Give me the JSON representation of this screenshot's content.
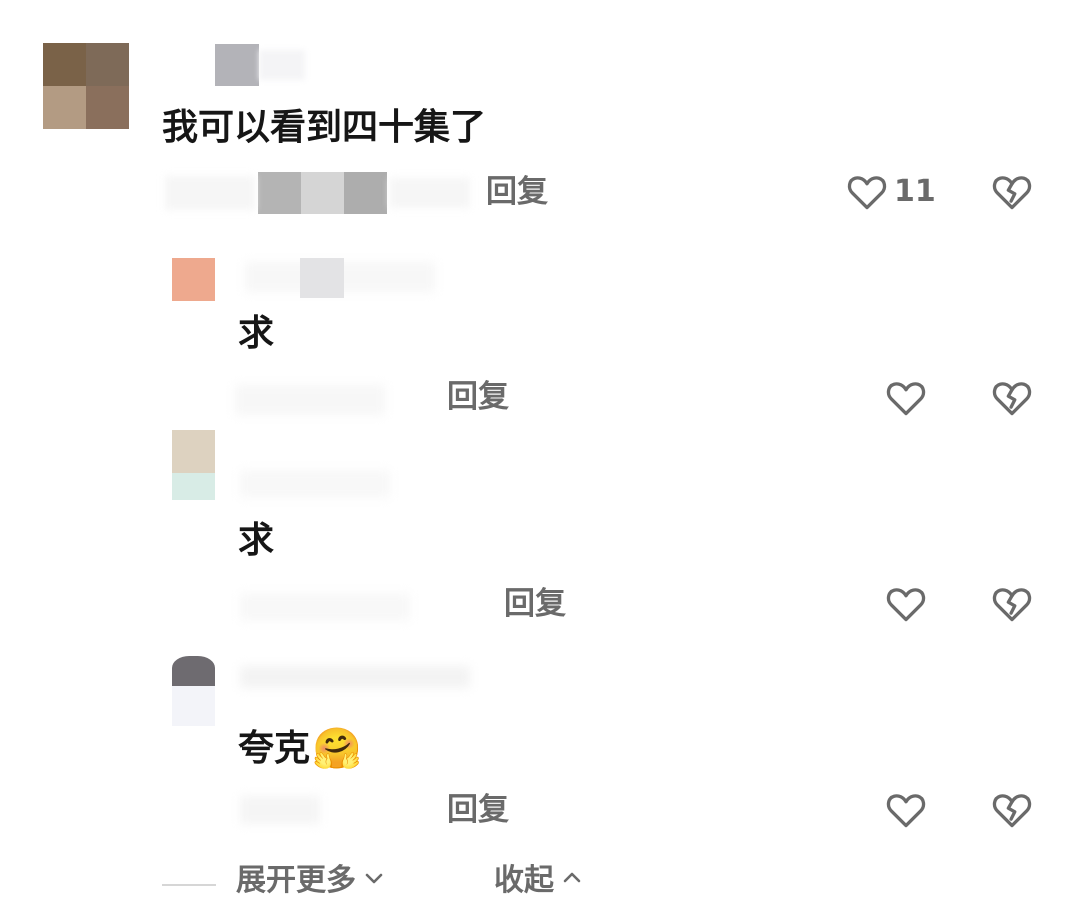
{
  "comment": {
    "text": "我可以看到四十集了",
    "reply_label": "回复",
    "like_count": "11"
  },
  "replies": [
    {
      "text": "求",
      "reply_label": "回复"
    },
    {
      "text": "求",
      "reply_label": "回复"
    },
    {
      "text": "夸克",
      "emoji": "🤗",
      "reply_label": "回复"
    }
  ],
  "footer": {
    "expand_label": "展开更多",
    "collapse_label": "收起"
  },
  "icons": {
    "like": "heart-outline-icon",
    "dislike": "broken-heart-icon"
  },
  "colors": {
    "text_primary": "#161616",
    "text_secondary": "#6a6a6a"
  }
}
